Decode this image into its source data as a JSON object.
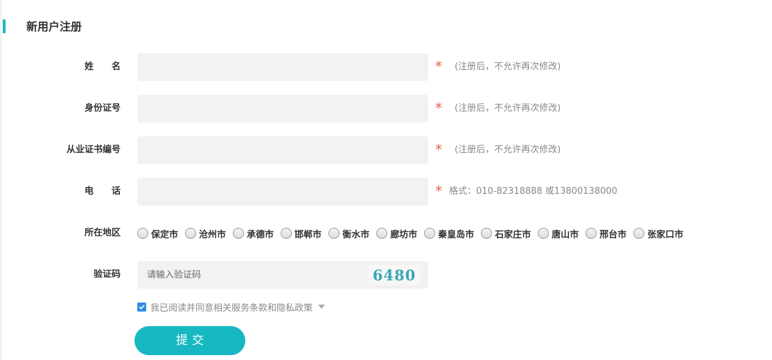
{
  "header": {
    "title": "新用户注册"
  },
  "fields": {
    "name": {
      "label": "姓　　名",
      "value": "",
      "placeholder": "",
      "required_mark": "*",
      "hint": "(注册后，不允许再次修改)"
    },
    "id_number": {
      "label": "身份证号",
      "value": "",
      "placeholder": "",
      "required_mark": "*",
      "hint": "(注册后，不允许再次修改)"
    },
    "cert_number": {
      "label": "从业证书编号",
      "value": "",
      "placeholder": "",
      "required_mark": "*",
      "hint": "(注册后，不允许再次修改)"
    },
    "phone": {
      "label": "电　　话",
      "value": "",
      "placeholder": "",
      "required_mark": "*",
      "hint": "格式：010-82318888 或13800138000"
    }
  },
  "region": {
    "label": "所在地区",
    "options": [
      "保定市",
      "沧州市",
      "承德市",
      "邯郸市",
      "衡水市",
      "廊坊市",
      "秦皇岛市",
      "石家庄市",
      "唐山市",
      "邢台市",
      "张家口市"
    ]
  },
  "captcha": {
    "label": "验证码",
    "placeholder": "请输入验证码",
    "value": "",
    "image_text": "6480",
    "image_color": "#3aa7b5"
  },
  "agreement": {
    "checked": true,
    "text": "我已阅读并同意相关服务条款和隐私政策"
  },
  "submit": {
    "label": "提交"
  },
  "colors": {
    "accent": "#18b8c3",
    "required": "#e8604c",
    "checkbox": "#2f8ae6",
    "input_bg": "#f2f2f2"
  },
  "icons": {
    "checkbox": "check-icon",
    "dropdown": "caret-down-icon"
  }
}
